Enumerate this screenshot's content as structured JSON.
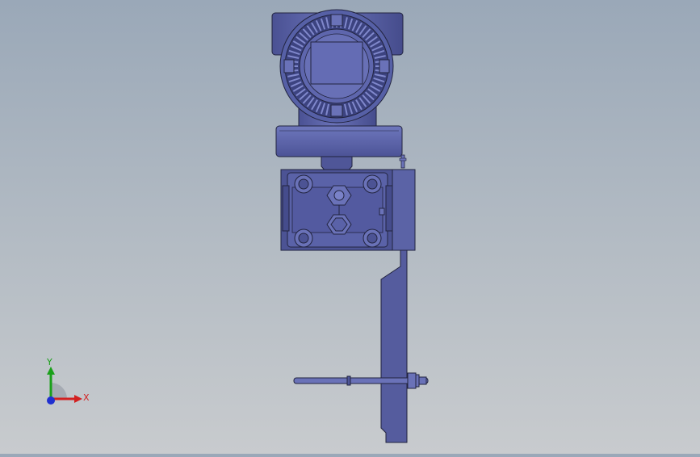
{
  "viewport": {
    "background_top": "#9aa8b8",
    "background_bottom": "#c8cbce",
    "model_color": "#5b63a6",
    "model_shade": "#3f4683",
    "model_outline": "#22243f"
  },
  "triad": {
    "x_label": "X",
    "y_label": "Y",
    "x_color": "#d22020",
    "y_color": "#1aa01a",
    "z_color": "#2030d0"
  }
}
